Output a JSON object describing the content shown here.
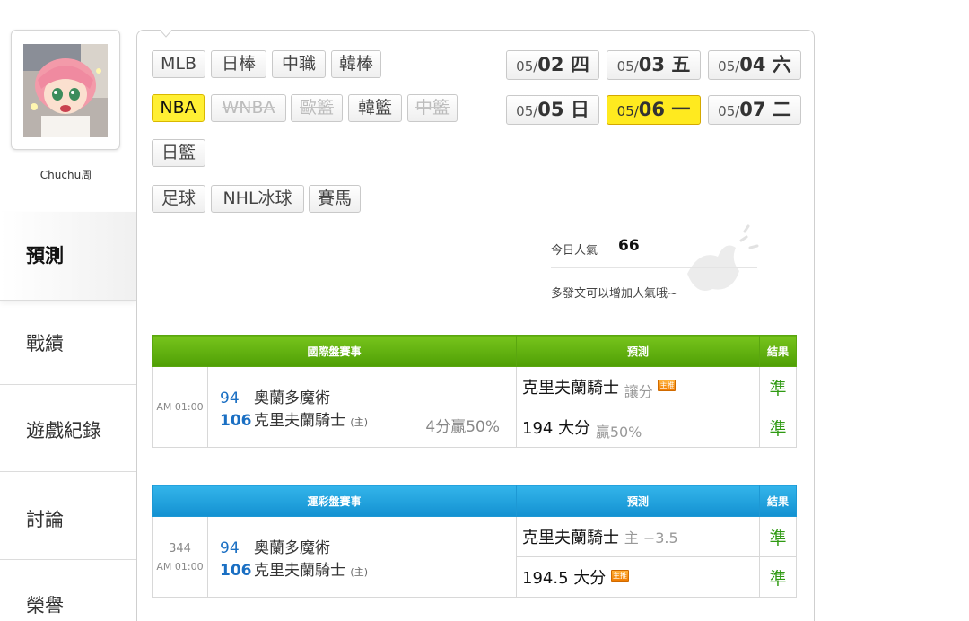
{
  "user": {
    "name": "Chuchu周"
  },
  "nav": {
    "predict": "預測",
    "record": "戰績",
    "game_log": "遊戲紀錄",
    "discuss": "討論",
    "honor": "榮譽"
  },
  "leagues": {
    "mlb": "MLB",
    "npb": "日棒",
    "cpbl": "中職",
    "kbo": "韓棒",
    "nba": "NBA",
    "wnba": "WNBA",
    "euro": "歐籃",
    "kbl": "韓籃",
    "cba": "中籃",
    "bleague": "日籃",
    "soccer": "足球",
    "nhl": "NHL冰球",
    "horse": "賽馬"
  },
  "dates": [
    {
      "md": "05/",
      "day": "02 四"
    },
    {
      "md": "05/",
      "day": "03 五"
    },
    {
      "md": "05/",
      "day": "04 六"
    },
    {
      "md": "05/",
      "day": "05 日"
    },
    {
      "md": "05/",
      "day": "06 一"
    },
    {
      "md": "05/",
      "day": "07 二"
    }
  ],
  "popularity": {
    "label": "今日人氣",
    "value": "66",
    "hint": "多發文可以增加人氣哦~"
  },
  "intl_table": {
    "header_match": "國際盤賽事",
    "header_pred": "預測",
    "header_result": "結果",
    "time": "AM 01:00",
    "away_score": "94",
    "away_team": "奧蘭多魔術",
    "home_score": "106",
    "home_team": "克里夫蘭騎士",
    "home_tag": "(主)",
    "odds": "4分贏50%",
    "pred1_main": "克里夫蘭騎士",
    "pred1_sub": "讓分",
    "pred1_badge": "主推",
    "result1": "準",
    "pred2_main": "194 大分",
    "pred2_sub": "贏50%",
    "result2": "準"
  },
  "lottery_table": {
    "header_match": "運彩盤賽事",
    "header_pred": "預測",
    "header_result": "結果",
    "game_no": "344",
    "time": "AM 01:00",
    "away_score": "94",
    "away_team": "奧蘭多魔術",
    "home_score": "106",
    "home_team": "克里夫蘭騎士",
    "home_tag": "(主)",
    "pred1_main": "克里夫蘭騎士",
    "pred1_sub": "主 −3.5",
    "result1": "準",
    "pred2_main": "194.5 大分",
    "pred2_badge": "主推",
    "result2": "準"
  }
}
